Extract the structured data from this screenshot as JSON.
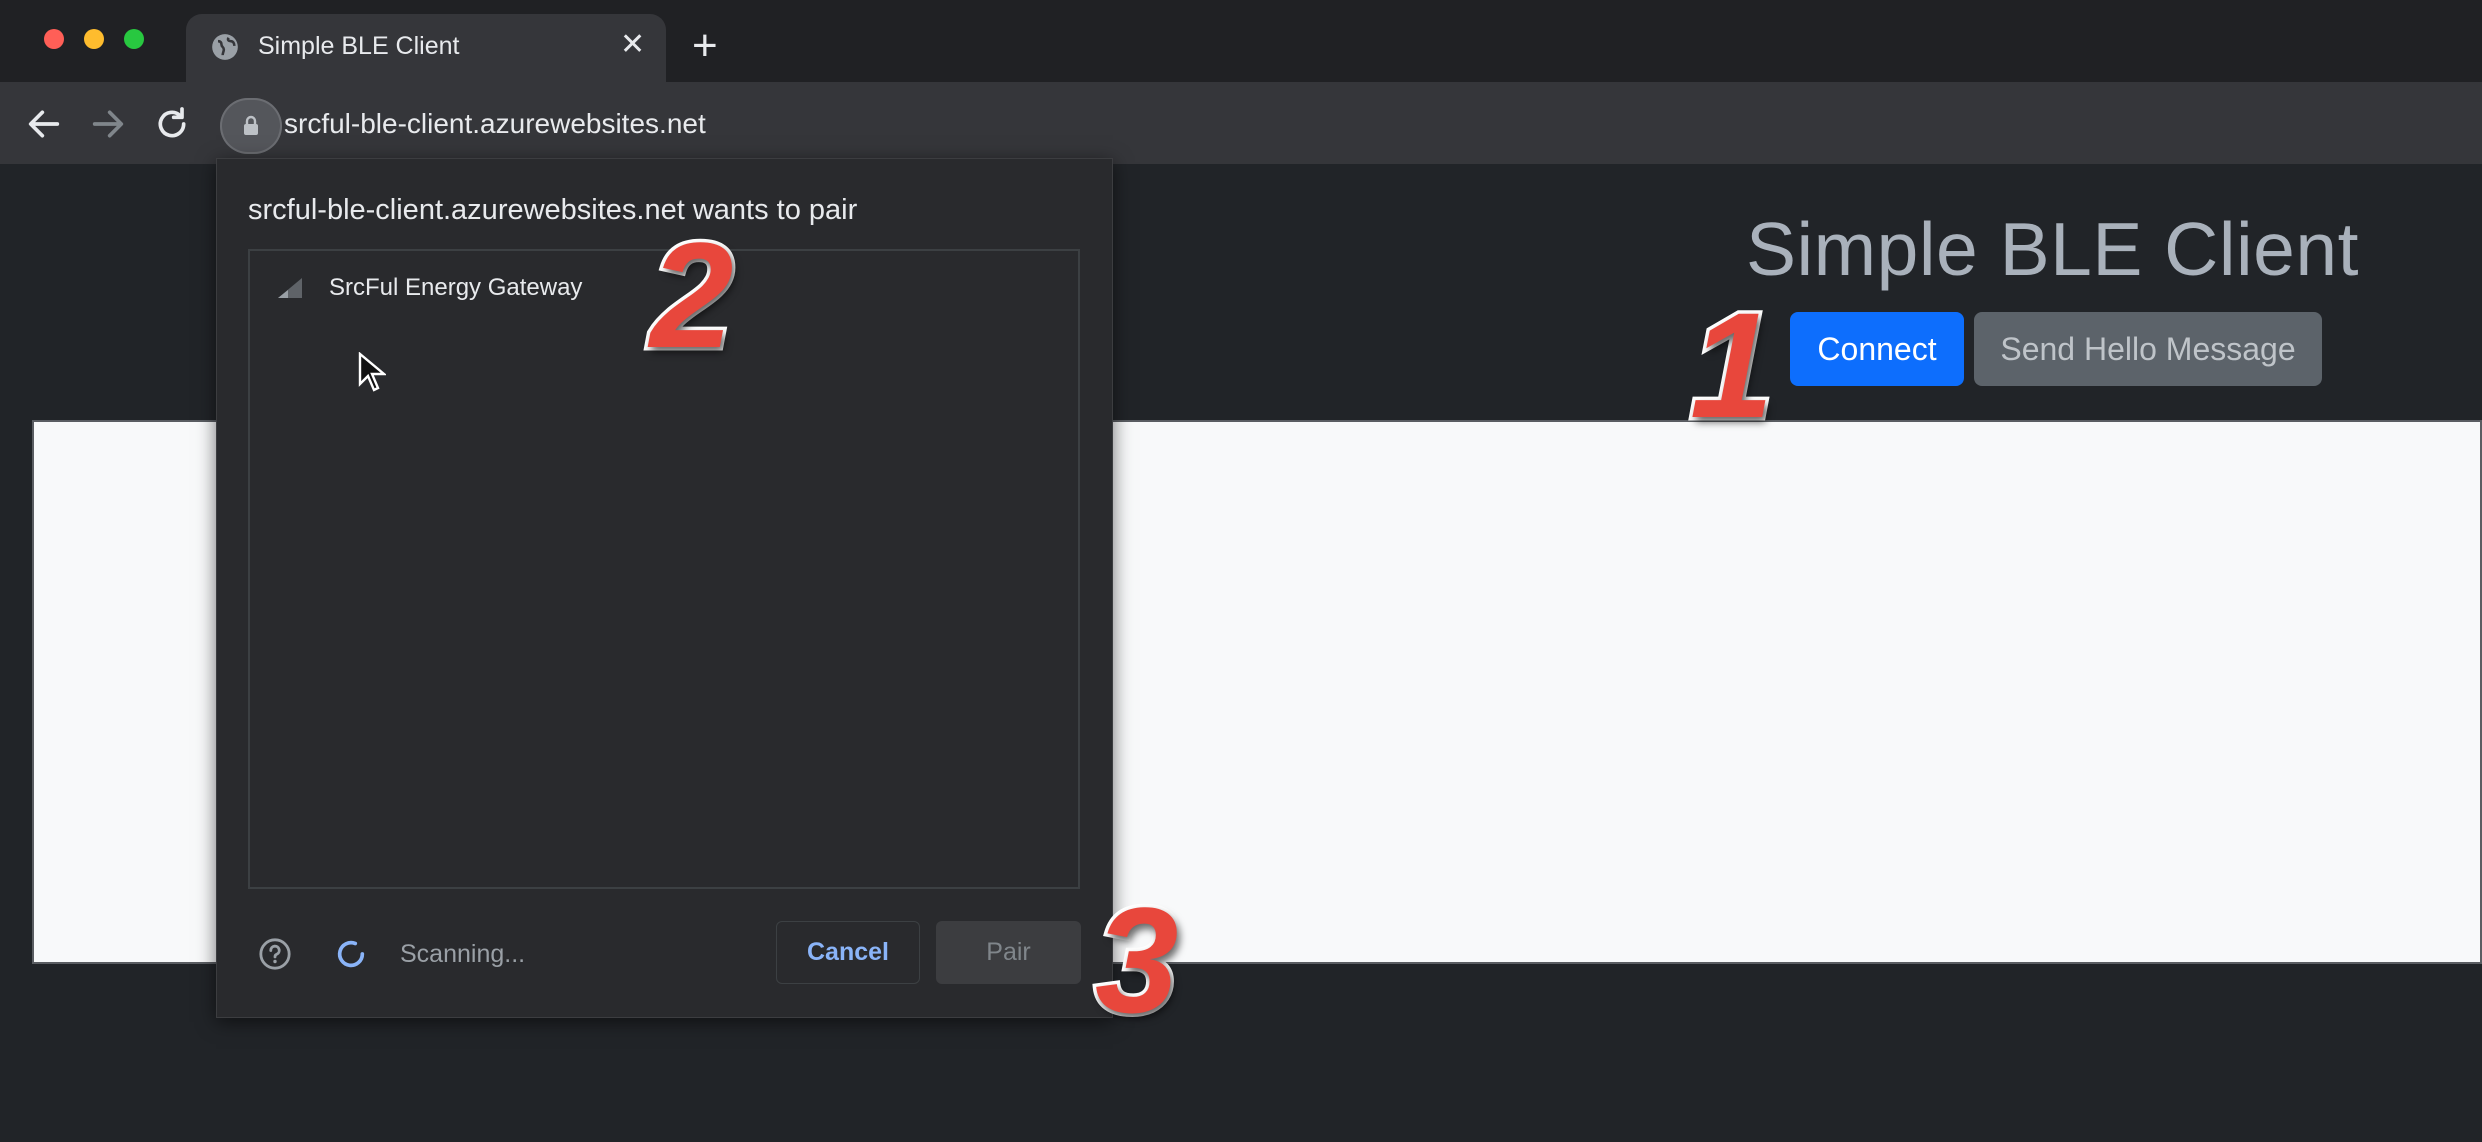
{
  "browser": {
    "tab": {
      "title": "Simple BLE Client",
      "icon": "globe-icon",
      "close_icon": "close-icon"
    },
    "new_tab_icon": "plus-icon",
    "window_controls": {
      "close_color": "#ff5f57",
      "minimize_color": "#febc2e",
      "maximize_color": "#28c840"
    },
    "toolbar": {
      "back_icon": "arrow-left-icon",
      "forward_icon": "arrow-right-icon",
      "reload_icon": "reload-icon",
      "site_info_icon": "lock-icon",
      "url": "srcful-ble-client.azurewebsites.net"
    }
  },
  "page": {
    "title": "Simple BLE Client",
    "connect_label": "Connect",
    "send_hello_label": "Send Hello Message",
    "colors": {
      "connect": "#0d6efd",
      "send_hello": "#5c636a"
    }
  },
  "dialog": {
    "title": "srcful-ble-client.azurewebsites.net wants to pair",
    "devices": [
      {
        "name": "SrcFul Energy Gateway",
        "icon": "signal-strength-icon"
      }
    ],
    "help_icon": "help-icon",
    "status_icon": "spinner-icon",
    "status": "Scanning...",
    "cancel_label": "Cancel",
    "pair_label": "Pair",
    "accent_color": "#8ab4f8"
  },
  "annotations": {
    "step1": "1",
    "step2": "2",
    "step3": "3",
    "color": "#e8473c"
  }
}
